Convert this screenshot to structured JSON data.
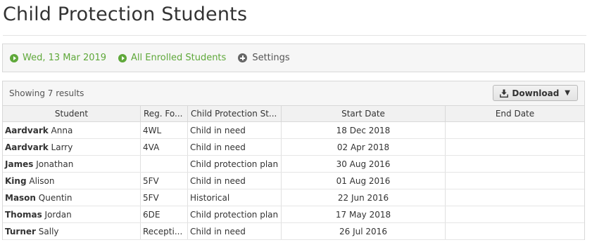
{
  "page": {
    "title": "Child Protection Students"
  },
  "filters": {
    "date": "Wed, 13 Mar 2019",
    "group": "All Enrolled Students",
    "settings": "Settings"
  },
  "results": {
    "count_text": "Showing 7 results",
    "download_label": "Download"
  },
  "table": {
    "columns": [
      "Student",
      "Reg. Fo...",
      "Child Protection St...",
      "Start Date",
      "End Date"
    ],
    "rows": [
      {
        "surname": "Aardvark",
        "forename": "Anna",
        "reg": "4WL",
        "status": "Child in need",
        "start": "18 Dec 2018",
        "end": ""
      },
      {
        "surname": "Aardvark",
        "forename": "Larry",
        "reg": "4VA",
        "status": "Child in need",
        "start": "02 Apr 2018",
        "end": ""
      },
      {
        "surname": "James",
        "forename": "Jonathan",
        "reg": "",
        "status": "Child protection plan",
        "start": "30 Aug 2016",
        "end": ""
      },
      {
        "surname": "King",
        "forename": "Alison",
        "reg": "5FV",
        "status": "Child in need",
        "start": "01 Aug 2016",
        "end": ""
      },
      {
        "surname": "Mason",
        "forename": "Quentin",
        "reg": "5FV",
        "status": "Historical",
        "start": "22 Jun 2016",
        "end": ""
      },
      {
        "surname": "Thomas",
        "forename": "Jordan",
        "reg": "6DE",
        "status": "Child protection plan",
        "start": "17 May 2018",
        "end": ""
      },
      {
        "surname": "Turner",
        "forename": "Sally",
        "reg": "Recepti...",
        "status": "Child in need",
        "start": "26 Jul 2016",
        "end": ""
      }
    ]
  },
  "icons": {
    "date": "play-circle-icon",
    "group": "play-circle-icon",
    "settings": "plus-circle-icon",
    "download": "download-icon",
    "download_menu": "caret-down-icon"
  },
  "colors": {
    "accent_green": "#5fa83a",
    "panel_bg": "#f6f6f6",
    "border": "#d8d8d8"
  }
}
